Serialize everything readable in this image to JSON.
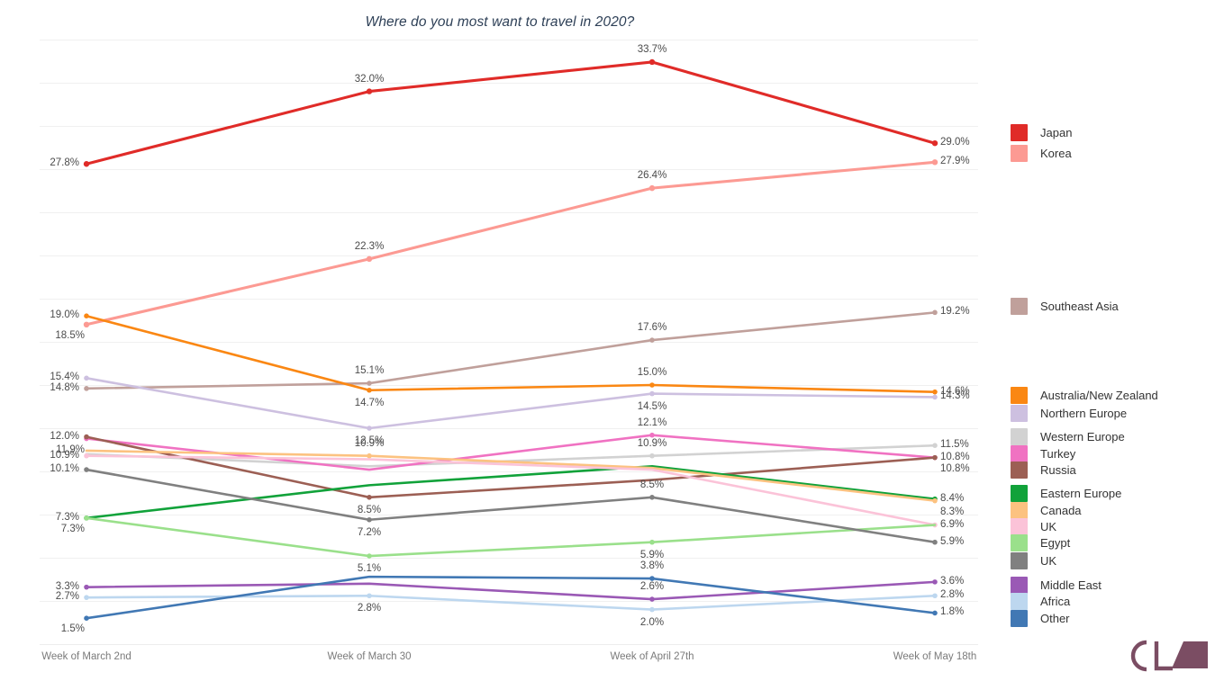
{
  "chart_title": "Where do you most want to travel in 2020?",
  "x_axis": {
    "ticks": [
      "Week of March 2nd",
      "Week of March 30",
      "Week of April 27th",
      "Week of May 18th"
    ]
  },
  "legend": {
    "position": "right",
    "items": [
      {
        "label": "Japan",
        "color": "#e02b28"
      },
      {
        "label": "Korea",
        "color": "#fc9a93"
      },
      {
        "label": "Southeast Asia",
        "color": "#c0a09b"
      },
      {
        "label": "Australia/New Zealand",
        "color": "#fa8713"
      },
      {
        "label": "Northern Europe",
        "color": "#cdc0e0"
      },
      {
        "label": "Western Europe",
        "color": "#d2d2d2"
      },
      {
        "label": "Turkey",
        "color": "#f072c2"
      },
      {
        "label": "Russia",
        "color": "#9c5f54"
      },
      {
        "label": "Eastern Europe",
        "color": "#11a23a"
      },
      {
        "label": "Canada",
        "color": "#fcc280"
      },
      {
        "label": "UK",
        "color": "#fbc3d8"
      },
      {
        "label": "Egypt",
        "color": "#9ae08b"
      },
      {
        "label": "UK",
        "color": "#808080"
      },
      {
        "label": "Middle East",
        "color": "#9a59b5"
      },
      {
        "label": "Africa",
        "color": "#bdd7ef"
      },
      {
        "label": "Other",
        "color": "#4178b4"
      }
    ]
  },
  "logo": {
    "text": "CLA",
    "color": "#7b4d63"
  },
  "chart_data": {
    "type": "line",
    "title": "Where do you most want to travel in 2020?",
    "xlabel": "",
    "ylabel": "",
    "ylim": [
      0,
      35
    ],
    "grid": true,
    "legend_position": "right",
    "value_format": "percent_one_decimal",
    "categories": [
      "Week of March 2nd",
      "Week of March 30",
      "Week of April 27th",
      "Week of May 18th"
    ],
    "series": [
      {
        "name": "Japan",
        "color": "#e02b28",
        "values": [
          27.8,
          32.0,
          33.7,
          29.0
        ],
        "labels": [
          "27.8%",
          "32.0%",
          "33.7%",
          "29.0%"
        ]
      },
      {
        "name": "Korea",
        "color": "#fc9a93",
        "values": [
          18.5,
          22.3,
          26.4,
          27.9
        ],
        "labels": [
          "18.5%",
          "22.3%",
          "26.4%",
          "27.9%"
        ]
      },
      {
        "name": "Southeast Asia",
        "color": "#c0a09b",
        "values": [
          14.8,
          15.1,
          17.6,
          19.2
        ],
        "labels": [
          "14.8%",
          "15.1%",
          "17.6%",
          "19.2%"
        ]
      },
      {
        "name": "Australia/New Zealand",
        "color": "#fa8713",
        "values": [
          19.0,
          14.7,
          15.0,
          14.6
        ],
        "labels": [
          "19.0%",
          "14.7%",
          "15.0%",
          "14.6%"
        ]
      },
      {
        "name": "Northern Europe",
        "color": "#cdc0e0",
        "values": [
          15.4,
          12.5,
          14.5,
          14.3
        ],
        "labels": [
          "15.4%",
          "12.5%",
          "14.5%",
          "14.3%"
        ]
      },
      {
        "name": "Western Europe",
        "color": "#d2d2d2",
        "values": [
          11.0,
          10.3,
          10.9,
          11.5
        ],
        "labels": [
          "",
          "",
          "10.9%",
          "11.5%"
        ]
      },
      {
        "name": "Turkey",
        "color": "#f072c2",
        "values": [
          11.9,
          10.1,
          12.1,
          10.8
        ],
        "labels": [
          "11.9%",
          "",
          "12.1%",
          "10.8%"
        ]
      },
      {
        "name": "Russia",
        "color": "#9c5f54",
        "values": [
          12.0,
          8.5,
          9.5,
          10.8
        ],
        "labels": [
          "12.0%",
          "8.5%",
          "",
          "10.8%"
        ]
      },
      {
        "name": "Eastern Europe",
        "color": "#11a23a",
        "values": [
          7.3,
          9.2,
          10.3,
          8.4
        ],
        "labels": [
          "7.3%",
          "",
          "",
          "8.4%"
        ]
      },
      {
        "name": "Canada",
        "color": "#fcc280",
        "values": [
          11.2,
          10.9,
          10.2,
          8.3
        ],
        "labels": [
          "",
          "10.9%",
          "",
          "8.3%"
        ]
      },
      {
        "name": "UK",
        "color": "#fbc3d8",
        "values": [
          10.9,
          10.7,
          10.1,
          6.9
        ],
        "labels": [
          "10.9%",
          "",
          "",
          "6.9%"
        ]
      },
      {
        "name": "Egypt",
        "color": "#9ae08b",
        "values": [
          7.3,
          5.1,
          5.9,
          6.9
        ],
        "labels": [
          "7.3%",
          "5.1%",
          "5.9%",
          ""
        ]
      },
      {
        "name": "UK",
        "color": "#808080",
        "values": [
          10.1,
          7.2,
          8.5,
          5.9
        ],
        "labels": [
          "10.1%",
          "7.2%",
          "8.5%",
          "5.9%"
        ]
      },
      {
        "name": "Middle East",
        "color": "#9a59b5",
        "values": [
          3.3,
          3.5,
          2.6,
          3.6
        ],
        "labels": [
          "3.3%",
          "",
          "2.6%",
          "3.6%"
        ]
      },
      {
        "name": "Africa",
        "color": "#bdd7ef",
        "values": [
          2.7,
          2.8,
          2.0,
          2.8
        ],
        "labels": [
          "2.7%",
          "2.8%",
          "2.0%",
          "2.8%"
        ]
      },
      {
        "name": "Other",
        "color": "#4178b4",
        "values": [
          1.5,
          3.9,
          3.8,
          1.8
        ],
        "labels": [
          "1.5%",
          "",
          "3.8%",
          "1.8%"
        ]
      }
    ]
  },
  "point_labels": {
    "col1": [
      "27.8%",
      "19.0%",
      "18.5%",
      "15.4%",
      "14.8%",
      "12.0%",
      "11.9%",
      "10.9%",
      "10.1%",
      "7.3%",
      "7.3%",
      "3.3%",
      "2.7%",
      "1.5%"
    ],
    "col2": [
      "32.0%",
      "22.3%",
      "15.1%",
      "14.7%",
      "12.5%",
      "10.9%",
      "8.5%",
      "7.2%",
      "5.1%",
      "2.8%"
    ],
    "col3": [
      "33.7%",
      "26.4%",
      "17.6%",
      "15.0%",
      "14.5%",
      "12.1%",
      "10.9%",
      "8.5%",
      "5.9%",
      "3.8%",
      "2.6%",
      "2.0%"
    ],
    "col4": [
      "29.0%",
      "27.9%",
      "19.2%",
      "14.6%",
      "14.3%",
      "11.5%",
      "10.8%",
      "10.8%",
      "8.4%",
      "8.3%",
      "6.9%",
      "5.9%",
      "3.6%",
      "2.8%",
      "1.8%"
    ]
  }
}
